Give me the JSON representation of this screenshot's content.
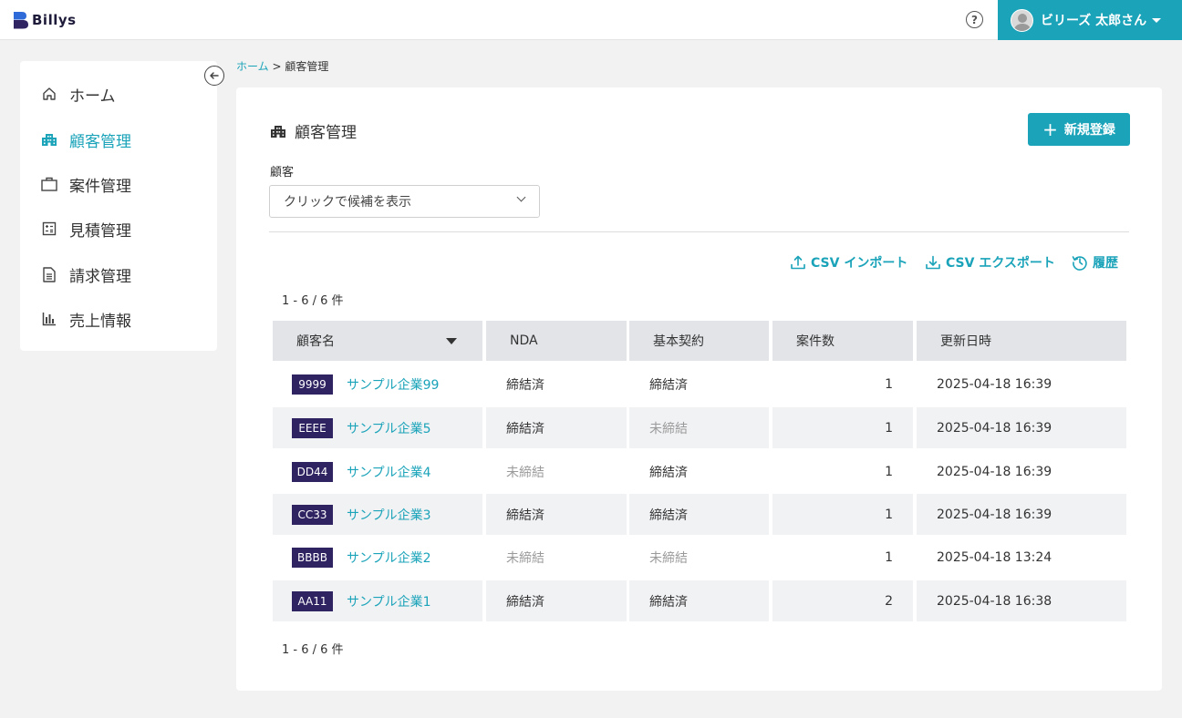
{
  "header": {
    "logo_text": "Billys",
    "help": "?",
    "user_name": "ビリーズ 太郎さん"
  },
  "sidebar": {
    "items": [
      {
        "label": "ホーム",
        "icon": "home-icon"
      },
      {
        "label": "顧客管理",
        "icon": "building-icon"
      },
      {
        "label": "案件管理",
        "icon": "briefcase-icon"
      },
      {
        "label": "見積管理",
        "icon": "calculator-icon"
      },
      {
        "label": "請求管理",
        "icon": "document-icon"
      },
      {
        "label": "売上情報",
        "icon": "bar-chart-icon"
      }
    ],
    "active_index": 1
  },
  "breadcrumb": {
    "home": "ホーム",
    "sep": ">",
    "current": "顧客管理"
  },
  "page": {
    "title": "顧客管理",
    "new_button": "新規登録",
    "filter_label": "顧客",
    "filter_placeholder": "クリックで候補を表示",
    "actions": {
      "csv_import": "CSV インポート",
      "csv_export": "CSV エクスポート",
      "history": "履歴"
    },
    "count_top": "1 - 6 / 6 件",
    "count_bottom": "1 - 6 / 6 件"
  },
  "colors": {
    "accent": "#1aa3b9",
    "badge": "#2f2362",
    "header_row": "#e2e4e8",
    "alt_row": "#f1f2f4"
  },
  "table": {
    "headers": [
      "顧客名",
      "NDA",
      "基本契約",
      "案件数",
      "更新日時"
    ],
    "rows": [
      {
        "code": "9999",
        "name": "サンプル企業99",
        "nda": "締結済",
        "contract": "締結済",
        "cases": "1",
        "updated": "2025-04-18 16:39"
      },
      {
        "code": "EEEE",
        "name": "サンプル企業5",
        "nda": "締結済",
        "contract": "未締結",
        "cases": "1",
        "updated": "2025-04-18 16:39"
      },
      {
        "code": "DD44",
        "name": "サンプル企業4",
        "nda": "未締結",
        "contract": "締結済",
        "cases": "1",
        "updated": "2025-04-18 16:39"
      },
      {
        "code": "CC33",
        "name": "サンプル企業3",
        "nda": "締結済",
        "contract": "締結済",
        "cases": "1",
        "updated": "2025-04-18 16:39"
      },
      {
        "code": "BBBB",
        "name": "サンプル企業2",
        "nda": "未締結",
        "contract": "未締結",
        "cases": "1",
        "updated": "2025-04-18 13:24"
      },
      {
        "code": "AA11",
        "name": "サンプル企業1",
        "nda": "締結済",
        "contract": "締結済",
        "cases": "2",
        "updated": "2025-04-18 16:38"
      }
    ]
  }
}
